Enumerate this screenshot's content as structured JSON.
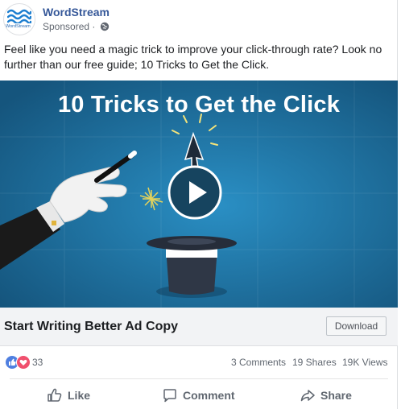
{
  "post": {
    "page_name": "WordStream",
    "sponsored_label": "Sponsored",
    "sponsored_separator": "·",
    "logo_text": "WordStream",
    "text": "Feel like you need a magic trick to improve your click-through rate? Look no further than our free guide; 10 Tricks to Get the Click."
  },
  "media": {
    "title": "10 Tricks to Get the Click",
    "type": "video",
    "play_icon": "play-icon"
  },
  "cta": {
    "headline": "Start Writing Better Ad Copy",
    "button_label": "Download"
  },
  "stats": {
    "reaction_count": "33",
    "comments": "3 Comments",
    "shares": "19 Shares",
    "views": "19K Views"
  },
  "actions": {
    "like": "Like",
    "comment": "Comment",
    "share": "Share"
  },
  "colors": {
    "brand_link": "#365899",
    "media_background": "#1b6c9b",
    "like_reaction": "#4f7fe0",
    "love_reaction": "#f0506e"
  }
}
